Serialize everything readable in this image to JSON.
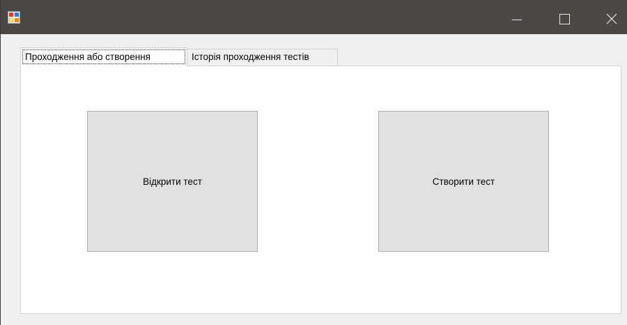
{
  "window": {
    "title": "",
    "controls": {
      "minimize": "minimize-icon",
      "maximize": "maximize-icon",
      "close": "close-icon"
    }
  },
  "tabs": [
    {
      "label": "Проходження або створення",
      "active": true
    },
    {
      "label": "Історія проходження тестів",
      "active": false
    }
  ],
  "main": {
    "open_test_label": "Відкрити тест",
    "create_test_label": "Створити тест"
  },
  "colors": {
    "titlebar": "#4b4845",
    "button_face": "#e1e1e1",
    "button_border": "#adadad",
    "form_background": "#f0f0f0"
  }
}
